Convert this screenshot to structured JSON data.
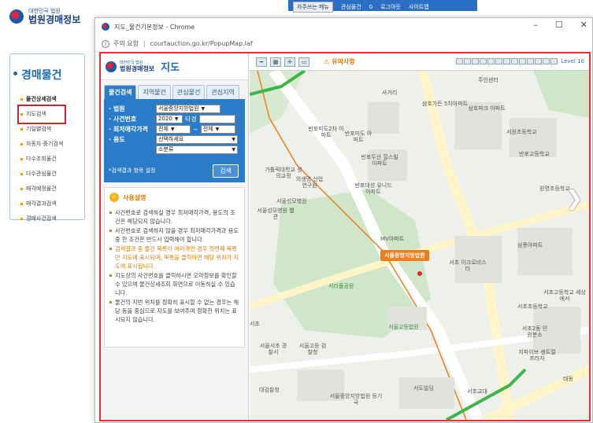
{
  "site": {
    "logo_sub": "대한민국 법원",
    "logo_main": "법원경매정보",
    "top_menu": "자주쓰는 메뉴",
    "top_links": [
      "관심물건",
      "로그아웃",
      "사이트맵"
    ],
    "top_badge": "0"
  },
  "left": {
    "title": "경매물건",
    "items": [
      "물건상세검색",
      "지도검색",
      "기일별검색",
      "자동차·중기검색",
      "다수조회물건",
      "다수관심물건",
      "매각예정물건",
      "매각결과검색",
      "경매사건검색"
    ]
  },
  "popup": {
    "window_title": "지도_물건기본정보 - Chrome",
    "address_label": "주의 요함",
    "url": "courtauction.go.kr/PopupMap.laf",
    "brand_sub": "대한민국 법원",
    "brand_main": "법원경매정보",
    "brand_map": "지도",
    "tabs": [
      "물건검색",
      "지역물건",
      "관심물건",
      "관심지역"
    ],
    "search": {
      "court_label": "법원",
      "court_value": "서울중앙지방법원",
      "case_label": "사건번호",
      "case_year": "2020",
      "case_suffix": "타경",
      "price_label": "최저매각가격",
      "price_from": "전체",
      "price_to": "전체",
      "use_label": "용도",
      "use_main": "선택하세요",
      "use_sub": "소분류",
      "note": "*검색결과 항목 설정",
      "button": "검색"
    },
    "guide": {
      "title": "사용설명",
      "items": [
        "사건번호로 검색하실 경우 최저매각가격, 용도의 조건은 해당되지 않습니다.",
        "사건번호로 검색하지 않을 경우 최저매각가격과 용도 중 한 조건은 반드시 입력해야 합니다.",
        "검색결과 중 물건 목록이 여러개인 경우 첫번째 목록만 지도에 표시되며, 목록을 클릭하면 해당 위치가 지도에 표시됩니다.",
        "지도상의 사건번호를 클릭하시면 오약정보를 확인할 수 있으며 물건상세조회 화면으로 이동하실 수 있습니다.",
        "물건의 지번 위치를 정확히 표시할 수 없는 경우는 해당 동을 중심으로 지도를 보여주며 정확한 위치는 표시되지 않습니다."
      ]
    },
    "map": {
      "warning": "유의사항",
      "level": "Level 10",
      "court_tag": "서울중앙지방법원",
      "labels": [
        "서초",
        "사거리",
        "주인센터",
        "삼호가든 5차아파트",
        "삼호파크 아파트",
        "반포미도2차 아파트",
        "반포미도 아파트",
        "반포두산 힐스빌아파트",
        "서원초등학교",
        "반포고등학교",
        "가톨릭대학교 성의교정",
        "의생명 산업연구원",
        "반포대성 유니드아파트",
        "원명초등학교",
        "서울성모병원 별관",
        "MV아파트",
        "서초 아크로비스타",
        "삼풍아파트",
        "서리풀공원",
        "서울고등법원",
        "서초초등학교",
        "서초2동 민원분소",
        "서울서초 경찰서",
        "서울고등 검찰청",
        "대검찰청",
        "서울중앙지방법원 등기국",
        "서도빌딩",
        "지파이브 센트럴프라자",
        "서초고등학교 세상에서",
        "서초교대",
        "태동",
        "서울성모병원"
      ]
    }
  }
}
